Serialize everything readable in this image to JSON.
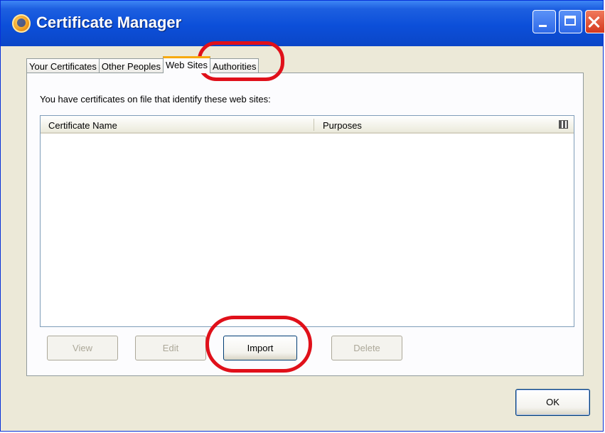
{
  "window": {
    "title": "Certificate Manager"
  },
  "titlebar_buttons": {
    "minimize": "minimize-icon",
    "maximize": "maximize-icon",
    "close": "close-icon"
  },
  "tabs": [
    {
      "label": "Your Certificates",
      "active": false
    },
    {
      "label": "Other Peoples",
      "active": false
    },
    {
      "label": "Web Sites",
      "active": true
    },
    {
      "label": "Authorities",
      "active": false
    }
  ],
  "panel": {
    "intro": "You have certificates on file that identify these web sites:",
    "columns": [
      "Certificate Name",
      "Purposes"
    ],
    "column_picker_icon": "column-picker-icon",
    "rows": []
  },
  "buttons": {
    "view": "View",
    "edit": "Edit",
    "import": "Import",
    "delete": "Delete",
    "ok": "OK"
  },
  "colors": {
    "titlebar": "#0c4fd9",
    "dialog_bg": "#ece9d8",
    "active_tab_accent": "#f7a90c",
    "annotation": "#e0101a"
  }
}
